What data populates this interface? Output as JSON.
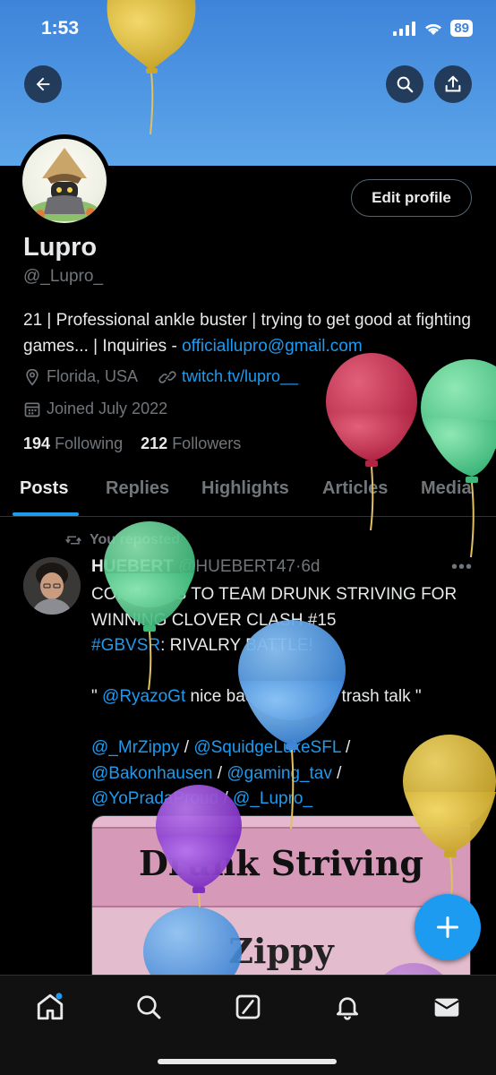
{
  "status_bar": {
    "time": "1:53",
    "battery": "89"
  },
  "profile": {
    "name": "Lupro",
    "handle": "@_Lupro_",
    "edit_profile_label": "Edit profile",
    "bio_text": "21 | Professional ankle buster | trying to get good at fighting games... | Inquiries - ",
    "bio_email": "officiallupro@gmail.com",
    "location": "Florida, USA",
    "website": "twitch.tv/lupro__",
    "joined": "Joined July 2022",
    "following_count": "194",
    "following_label": "Following",
    "followers_count": "212",
    "followers_label": "Followers"
  },
  "tabs": [
    {
      "label": "Posts",
      "active": true
    },
    {
      "label": "Replies",
      "active": false
    },
    {
      "label": "Highlights",
      "active": false
    },
    {
      "label": "Articles",
      "active": false
    },
    {
      "label": "Media",
      "active": false
    }
  ],
  "post": {
    "repost_label": "You reposted",
    "author_name": "HUEBERT",
    "author_handle": "@HUEBERT47",
    "separator": "·",
    "time_ago": "6d",
    "more_label": "•••",
    "line1": "CONGRATS TO TEAM DRUNK STRIVING FOR WINNING CLOVER CLASH #15",
    "hashtag": "#GBVSR",
    "line2_rest": ": RIVALRY BATTLE!",
    "quote_open": "\" ",
    "quote_mention": "@RyazoGt",
    "quote_rest": " nice backin up your trash talk \"",
    "mentions": [
      "@_MrZippy",
      "@SquidgeLukeSFL",
      "@Bakonhausen",
      "@gaming_tav",
      "@YoPradaProud",
      "@_Lupro_"
    ],
    "mention_sep": " / ",
    "media_title": "Drunk Striving",
    "media_subtitle": "Zippy"
  },
  "icons": {
    "back": "arrow-left-icon",
    "search": "search-icon",
    "share": "share-icon",
    "location": "map-pin-icon",
    "link": "link-icon",
    "calendar": "calendar-icon",
    "repost": "repost-icon",
    "compose": "plus-icon",
    "nav": [
      "home-icon",
      "search-icon",
      "grok-icon",
      "bell-icon",
      "mail-icon"
    ]
  },
  "colors": {
    "accent": "#1d9bf0",
    "banner": "#4a90e2",
    "background": "#000000",
    "muted": "#71767b",
    "text": "#e7e9ea"
  }
}
